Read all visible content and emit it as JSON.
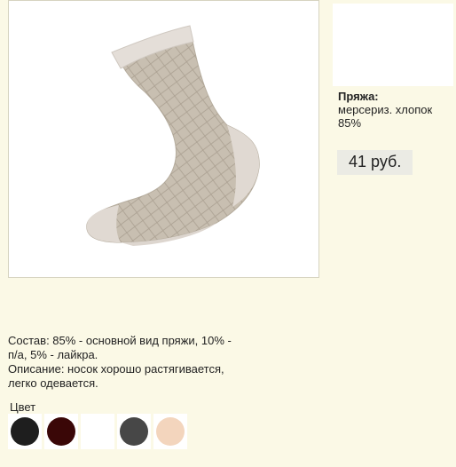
{
  "product": {
    "image_alt": "sock-photo"
  },
  "details": {
    "yarn_label": "Пряжа:",
    "yarn_value": "мерсериз. хлопок 85%",
    "price": "41 руб."
  },
  "description": {
    "composition": "Состав: 85% - основной вид пряжи, 10% - п/а, 5% - лайкра.",
    "text": "Описание: носок хорошо растягивается, легко одевается."
  },
  "colors": {
    "title": "Цвет",
    "swatches": [
      {
        "name": "black",
        "hex": "#1e1e1e"
      },
      {
        "name": "dark-brown",
        "hex": "#3a0707"
      },
      {
        "name": "white",
        "hex": "#ffffff"
      },
      {
        "name": "dark-grey",
        "hex": "#474747"
      },
      {
        "name": "beige",
        "hex": "#f3d5bd"
      }
    ]
  },
  "theme": {
    "page_bg": "#fbf9e6",
    "sock_body": "#c8bfb1",
    "sock_cuff": "#e2dcd6",
    "sock_pattern": "#9d9283"
  }
}
